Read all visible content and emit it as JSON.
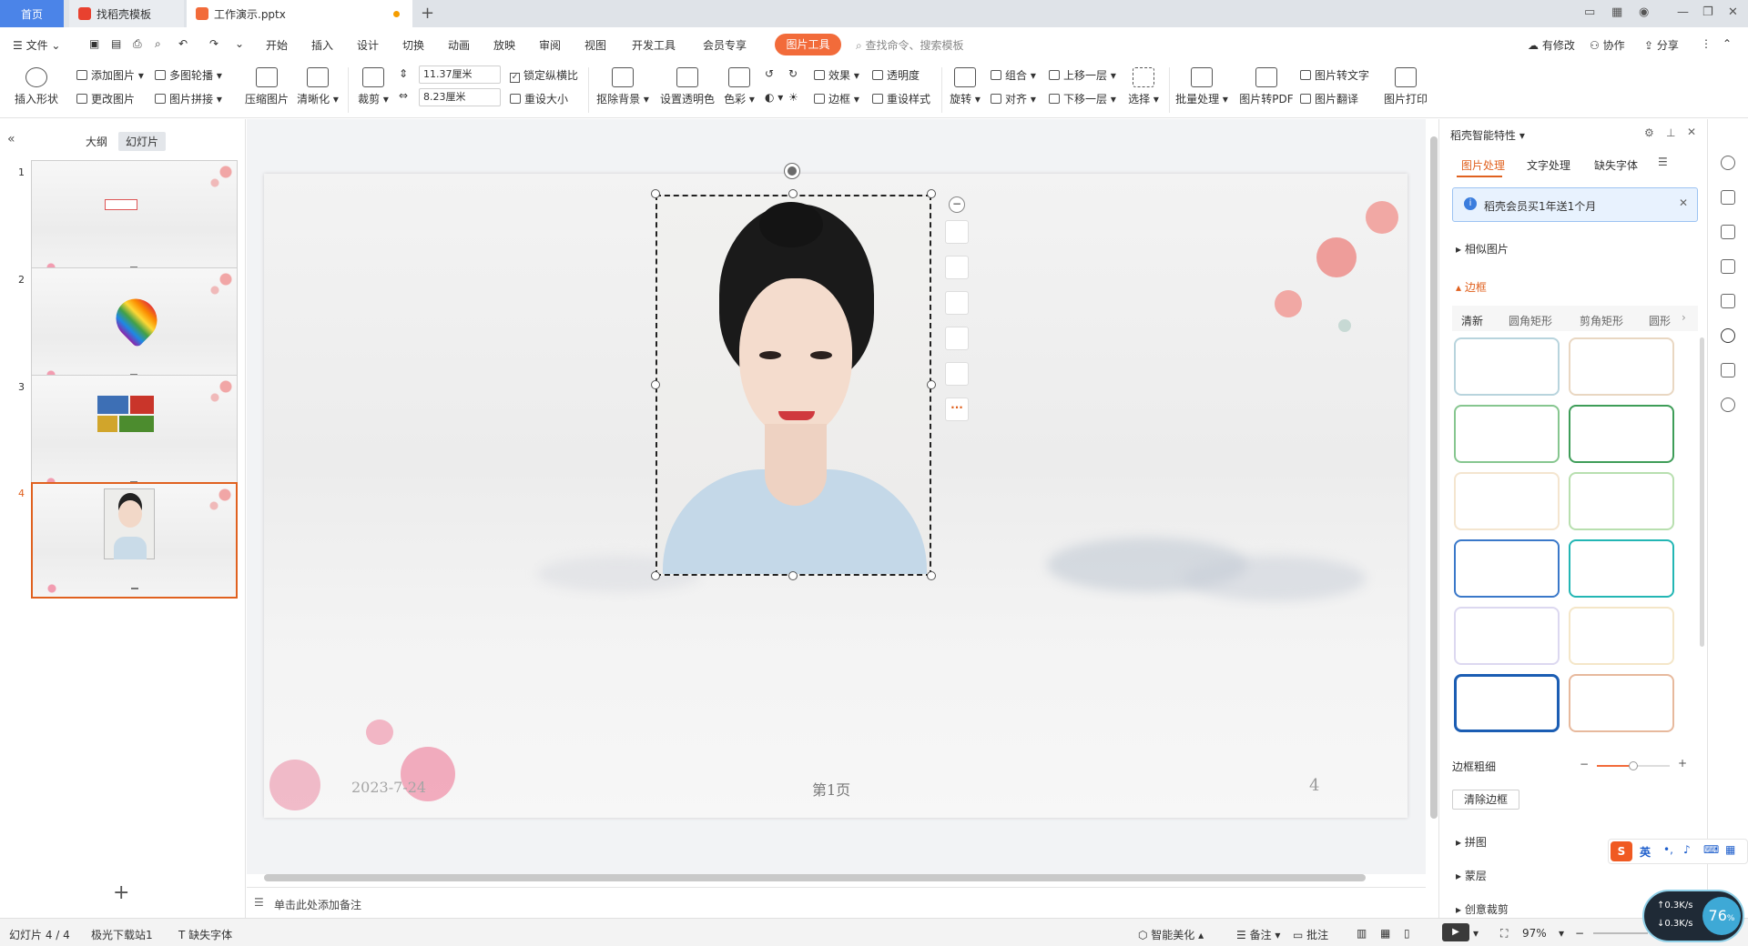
{
  "tabs": {
    "home": "首页",
    "template_tab": "找稻壳模板",
    "doc_tab": "工作演示.pptx"
  },
  "menu": {
    "file": "文件",
    "items": [
      "开始",
      "插入",
      "设计",
      "切换",
      "动画",
      "放映",
      "审阅",
      "视图",
      "开发工具",
      "会员专享"
    ],
    "active": "图片工具",
    "search_placeholder": "查找命令、搜索模板",
    "right": [
      "有修改",
      "协作",
      "分享"
    ]
  },
  "ribbon": {
    "insert_shape": "插入形状",
    "add_picture": "添加图片",
    "change_picture": "更改图片",
    "multi_carousel": "多图轮播",
    "picture_collage": "图片拼接",
    "compress": "压缩图片",
    "sharpen": "清晰化",
    "crop": "裁剪",
    "width": "11.37厘米",
    "height": "8.23厘米",
    "lock_ratio": "锁定纵横比",
    "reset_size": "重设大小",
    "remove_bg": "抠除背景",
    "set_transparent": "设置透明色",
    "color": "色彩",
    "effects": "效果",
    "transparency": "透明度",
    "border": "边框",
    "reset_style": "重设样式",
    "rotate": "旋转",
    "group": "组合",
    "align": "对齐",
    "bring_forward": "上移一层",
    "send_backward": "下移一层",
    "select": "选择",
    "batch": "批量处理",
    "to_pdf": "图片转PDF",
    "to_text": "图片转文字",
    "translate": "图片翻译",
    "print": "图片打印"
  },
  "left_panel": {
    "outline_tab": "大纲",
    "slides_tab": "幻灯片",
    "slide_numbers": [
      "1",
      "2",
      "3",
      "4"
    ],
    "add_slide": "+"
  },
  "slide": {
    "date": "2023-7-24",
    "page_label": "第1页",
    "page_number": "4"
  },
  "notes_placeholder": "单击此处添加备注",
  "right_panel": {
    "title": "稻壳智能特性",
    "tabs": [
      "图片处理",
      "文字处理",
      "缺失字体"
    ],
    "banner": "稻壳会员买1年送1个月",
    "similar": "相似图片",
    "border_section": "边框",
    "border_tabs": [
      "清新",
      "圆角矩形",
      "剪角矩形",
      "圆形"
    ],
    "thickness": "边框粗细",
    "thickness_level": 0.5,
    "clear_border": "清除边框",
    "collage": "拼图",
    "mask": "蒙层",
    "creative_crop": "创意裁剪"
  },
  "status": {
    "slide_pos": "幻灯片 4 / 4",
    "theme": "极光下载站1",
    "missing_font": "缺失字体",
    "beautify": "智能美化",
    "notes": "备注",
    "comments": "批注",
    "zoom": "97%",
    "net_up": "0.3K/s",
    "net_down": "0.3K/s",
    "cpu": "76",
    "ime": "英"
  },
  "colors": {
    "accent": "#e0611f",
    "tab_home": "#4b84e8",
    "active_menu": "#f26b3a"
  }
}
